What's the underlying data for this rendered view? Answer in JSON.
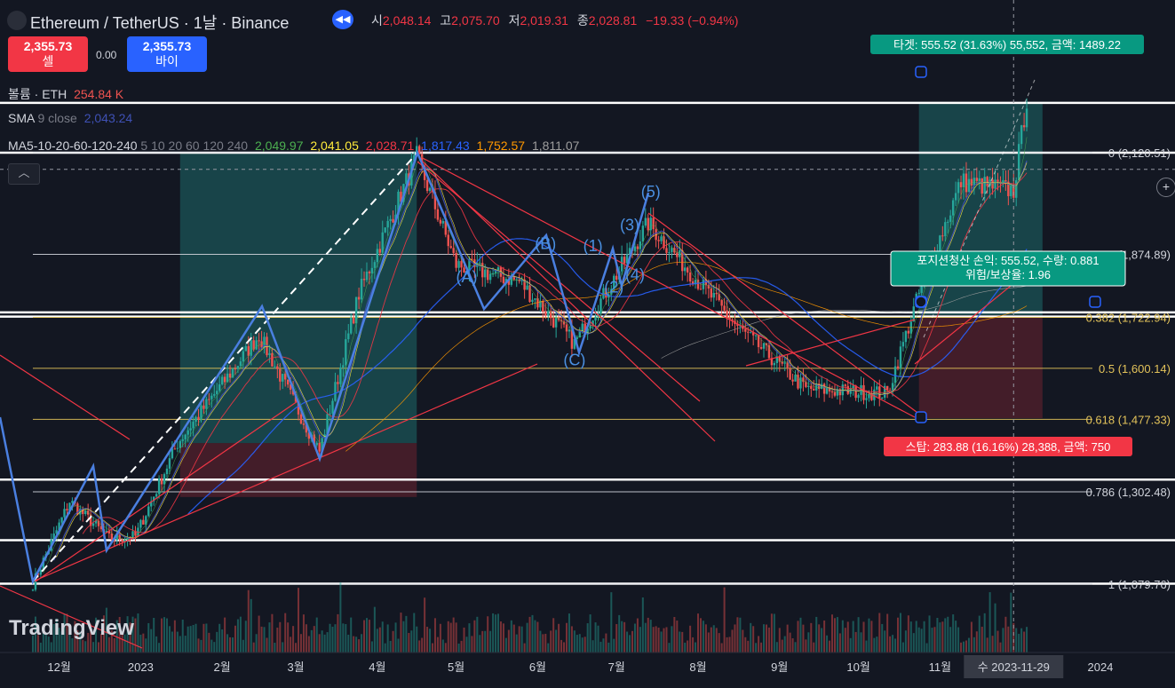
{
  "header": {
    "title": "Ethereum / TetherUS · 1날 · Binance",
    "ohlc": [
      {
        "label": "시",
        "value": "2,048.14"
      },
      {
        "label": "고",
        "value": "2,075.70"
      },
      {
        "label": "저",
        "value": "2,019.31"
      },
      {
        "label": "종",
        "value": "2,028.81"
      }
    ],
    "change": "−19.33 (−0.94%)"
  },
  "trade": {
    "sell_price": "2,355.73",
    "sell_label": "셀",
    "spread": "0.00",
    "buy_price": "2,355.73",
    "buy_label": "바이"
  },
  "indicators": {
    "volume": {
      "name": "볼륨 · ETH",
      "value": "254.84 K",
      "color": "#ef5350"
    },
    "sma": {
      "name": "SMA",
      "params": "9 close",
      "value": "2,043.24",
      "color": "#3f51b5"
    },
    "ma": {
      "name": "MA5-10-20-60-120-240",
      "params": "5 10 20 60 120 240",
      "values": [
        {
          "value": "2,049.97",
          "color": "#4caf50"
        },
        {
          "value": "2,041.05",
          "color": "#ffeb3b"
        },
        {
          "value": "2,028.71",
          "color": "#f23645"
        },
        {
          "value": "1,817.43",
          "color": "#2962ff"
        },
        {
          "value": "1,752.57",
          "color": "#ff9800"
        },
        {
          "value": "1,811.07",
          "color": "#9e9e9e"
        }
      ]
    }
  },
  "watermark": "TradingView",
  "colors": {
    "background": "#131722",
    "up": "#26a69a",
    "down": "#ef5350",
    "wave": "#4a90e2"
  },
  "chart_data": {
    "type": "candlestick",
    "symbol": "ETH/USDT",
    "interval": "1D",
    "y_range": [
      1000,
      2230
    ],
    "x_range": [
      "2022-11-19",
      "2024-01-10"
    ],
    "x_ticks": [
      {
        "date": "2022-12-01",
        "label": "12월"
      },
      {
        "date": "2023-01-01",
        "label": "2023"
      },
      {
        "date": "2023-02-01",
        "label": "2월"
      },
      {
        "date": "2023-03-01",
        "label": "3월"
      },
      {
        "date": "2023-04-01",
        "label": "4월"
      },
      {
        "date": "2023-05-01",
        "label": "5월"
      },
      {
        "date": "2023-06-01",
        "label": "6월"
      },
      {
        "date": "2023-07-01",
        "label": "7월"
      },
      {
        "date": "2023-08-01",
        "label": "8월"
      },
      {
        "date": "2023-09-01",
        "label": "9월"
      },
      {
        "date": "2023-10-01",
        "label": "10월"
      },
      {
        "date": "2023-11-01",
        "label": "11월"
      },
      {
        "date": "2024-01-01",
        "label": "2024"
      }
    ],
    "crosshair": {
      "date": "2023-11-29",
      "label": "수 2023-11-29",
      "price": 2080
    },
    "price_path": [
      {
        "date": "2022-11-21",
        "close": 1080
      },
      {
        "date": "2022-12-05",
        "close": 1280
      },
      {
        "date": "2022-12-20",
        "close": 1190
      },
      {
        "date": "2022-12-30",
        "close": 1195
      },
      {
        "date": "2023-01-15",
        "close": 1420
      },
      {
        "date": "2023-02-15",
        "close": 1680
      },
      {
        "date": "2023-03-10",
        "close": 1400
      },
      {
        "date": "2023-03-25",
        "close": 1780
      },
      {
        "date": "2023-04-16",
        "close": 2110
      },
      {
        "date": "2023-05-01",
        "close": 1850
      },
      {
        "date": "2023-05-25",
        "close": 1810
      },
      {
        "date": "2023-06-15",
        "close": 1660
      },
      {
        "date": "2023-07-13",
        "close": 1950
      },
      {
        "date": "2023-08-16",
        "close": 1700
      },
      {
        "date": "2023-09-11",
        "close": 1550
      },
      {
        "date": "2023-10-12",
        "close": 1540
      },
      {
        "date": "2023-10-24",
        "close": 1780
      },
      {
        "date": "2023-11-09",
        "close": 2050
      },
      {
        "date": "2023-11-29",
        "close": 2028.81
      },
      {
        "date": "2023-12-04",
        "close": 2250
      }
    ],
    "fib_levels": [
      {
        "ratio": "0",
        "price": 2120.51,
        "label": "0 (2,120.51)",
        "color": "#d1d4dc"
      },
      {
        "ratio": "0.236",
        "price": 1874.89,
        "label": "0.236 (1,874.89)",
        "color": "#d1d4dc"
      },
      {
        "ratio": "0.382",
        "price": 1722.94,
        "label": "0.382 (1,722.94)",
        "color": "#e3c35a"
      },
      {
        "ratio": "0.5",
        "price": 1600.14,
        "label": "0.5 (1,600.14)",
        "color": "#e3c35a"
      },
      {
        "ratio": "0.618",
        "price": 1477.33,
        "label": "0.618 (1,477.33)",
        "color": "#e3c35a"
      },
      {
        "ratio": "0.786",
        "price": 1302.48,
        "label": "0.786 (1,302.48)",
        "color": "#d1d4dc"
      },
      {
        "ratio": "1",
        "price": 1079.76,
        "label": "1 (1,079.76)",
        "color": "#d1d4dc"
      }
    ],
    "horizontal_lines": [
      2240,
      2120,
      1735,
      1725,
      1332,
      1186,
      1081
    ],
    "wave_points": [
      {
        "date": "2023-04-27",
        "price": 1805
      },
      {
        "date": "2023-05-05",
        "price": 1825,
        "label": "(A)"
      },
      {
        "date": "2023-06-04",
        "price": 1905,
        "label": "(B)"
      },
      {
        "date": "2023-06-15",
        "price": 1625,
        "label": "(C)"
      },
      {
        "date": "2023-06-22",
        "price": 1900,
        "label": "(1)"
      },
      {
        "date": "2023-06-30",
        "price": 1800,
        "label": "(2)"
      },
      {
        "date": "2023-07-06",
        "price": 1950,
        "label": "(3)"
      },
      {
        "date": "2023-07-08",
        "price": 1830,
        "label": "(4)"
      },
      {
        "date": "2023-07-14",
        "price": 2030,
        "label": "(5)"
      }
    ],
    "positions": [
      {
        "entry_date": "2023-01-16",
        "exit_date": "2023-04-16",
        "entry_price": 1420,
        "target_price": 2120,
        "stop_price": 1290,
        "type": "long"
      },
      {
        "entry_date": "2023-10-24",
        "exit_date": "2023-12-10",
        "entry_price": 1728,
        "target_price": 2240,
        "stop_price": 1480,
        "type": "long"
      }
    ],
    "position_labels": {
      "target": "타겟: 555.52 (31.63%) 55,552, 금액: 1489.22",
      "stop": "스탑: 283.88 (16.16%) 28,388, 금액: 750",
      "status_line1": "포지션청산 손익: 555.52, 수량: 0.881",
      "status_line2": "위험/보상율: 1.96"
    }
  }
}
